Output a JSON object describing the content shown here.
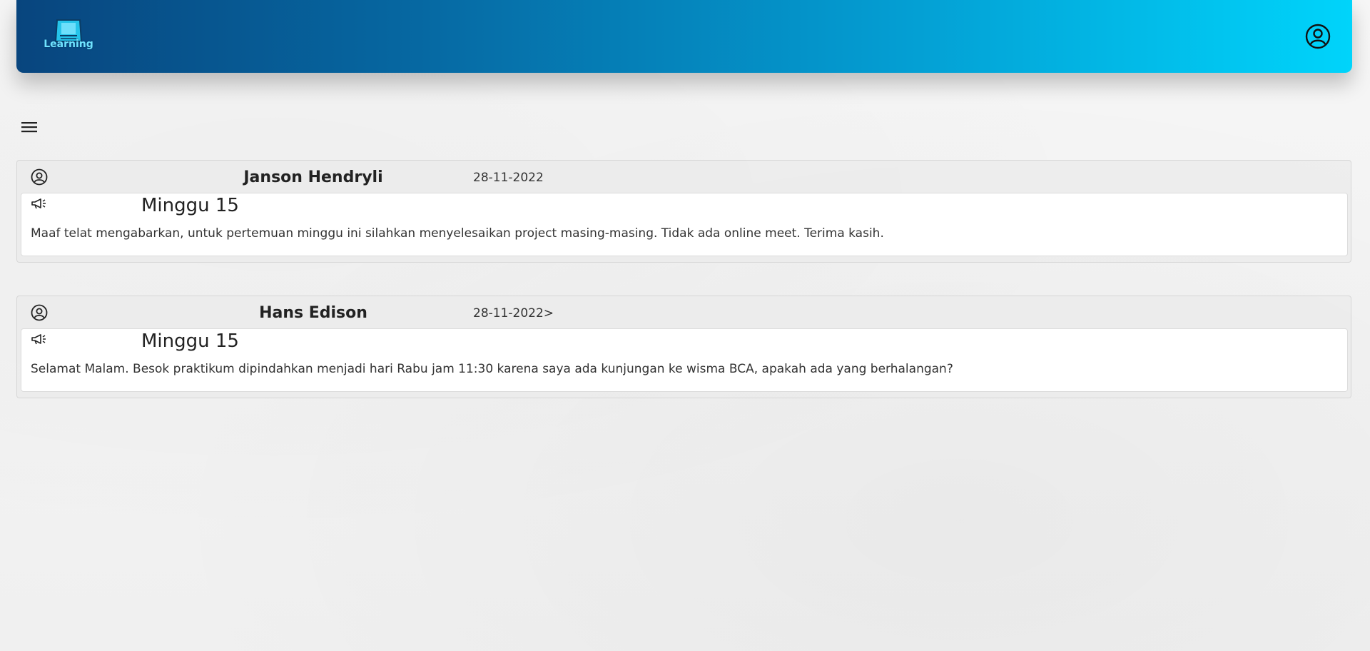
{
  "header": {
    "logo_text": "Learning",
    "profile_icon": "user-circle-icon"
  },
  "toolbar": {
    "menu_icon": "hamburger-menu-icon"
  },
  "posts": [
    {
      "author": "Janson Hendryli",
      "date": "28-11-2022",
      "title": "Minggu 15",
      "message": "Maaf telat mengabarkan, untuk pertemuan minggu ini silahkan menyelesaikan project masing-masing. Tidak ada online meet. Terima kasih.",
      "avatar_icon": "user-circle-icon",
      "announcement_icon": "megaphone-icon"
    },
    {
      "author": "Hans Edison",
      "date": "28-11-2022>",
      "title": "Minggu 15",
      "message": "Selamat Malam. Besok praktikum dipindahkan menjadi hari Rabu jam 11:30 karena saya ada kunjungan ke wisma BCA, apakah ada yang berhalangan?",
      "avatar_icon": "user-circle-icon",
      "announcement_icon": "megaphone-icon"
    }
  ],
  "colors": {
    "navbar_start": "#08457e",
    "navbar_end": "#00d4fb",
    "logo_accent": "#6fe3ff"
  }
}
